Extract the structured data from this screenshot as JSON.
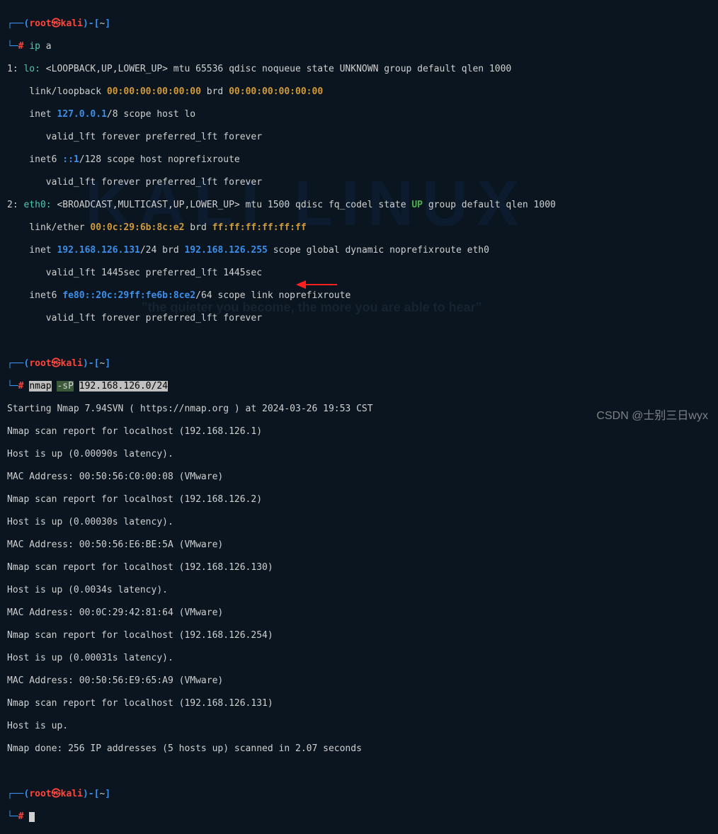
{
  "bg": {
    "logo": "KALI LINUX",
    "tagline": "\"the quieter you become, the more you are able to hear\""
  },
  "prompt": {
    "open": "┌──(",
    "user": "root",
    "at": "㉿",
    "host": "kali",
    "close": ")-[",
    "path": "~",
    "end": "]",
    "line2": "└─",
    "hash": "#"
  },
  "cmd1": {
    "cmd": "ip",
    "arg": "a"
  },
  "ip": {
    "l1_idx": "1: ",
    "l1_ifc": "lo:",
    "l1_rest": " <LOOPBACK,UP,LOWER_UP> mtu 65536 qdisc noqueue state UNKNOWN group default qlen 1000",
    "l2_a": "    link/loopback ",
    "l2_mac1": "00:00:00:00:00:00",
    "l2_b": " brd ",
    "l2_mac2": "00:00:00:00:00:00",
    "l3_a": "    inet ",
    "l3_ip": "127.0.0.1",
    "l3_b": "/8 scope host lo",
    "l4": "       valid_lft forever preferred_lft forever",
    "l5_a": "    inet6 ",
    "l5_ip": "::1",
    "l5_b": "/128 scope host noprefixroute",
    "l6": "       valid_lft forever preferred_lft forever",
    "l7_idx": "2: ",
    "l7_ifc": "eth0:",
    "l7_a": " <BROADCAST,MULTICAST,UP,LOWER_UP> mtu 1500 qdisc fq_codel state ",
    "l7_up": "UP",
    "l7_b": " group default qlen 1000",
    "l8_a": "    link/ether ",
    "l8_mac1": "00:0c:29:6b:8c:e2",
    "l8_b": " brd ",
    "l8_mac2": "ff:ff:ff:ff:ff:ff",
    "l9_a": "    inet ",
    "l9_ip": "192.168.126.131",
    "l9_b": "/24 brd ",
    "l9_brd": "192.168.126.255",
    "l9_c": " scope global dynamic noprefixroute eth0",
    "l10": "       valid_lft 1445sec preferred_lft 1445sec",
    "l11_a": "    inet6 ",
    "l11_ip": "fe80::20c:29ff:fe6b:8ce2",
    "l11_b": "/64 scope link noprefixroute",
    "l12": "       valid_lft forever preferred_lft forever"
  },
  "cmd2": {
    "cmd": "nmap",
    "opt": "-sP",
    "tgt": "192.168.126.0/24"
  },
  "nmap": {
    "l1": "Starting Nmap 7.94SVN ( https://nmap.org ) at 2024-03-26 19:53 CST",
    "l2": "Nmap scan report for localhost (192.168.126.1)",
    "l3": "Host is up (0.00090s latency).",
    "l4": "MAC Address: 00:50:56:C0:00:08 (VMware)",
    "l5": "Nmap scan report for localhost (192.168.126.2)",
    "l6": "Host is up (0.00030s latency).",
    "l7": "MAC Address: 00:50:56:E6:BE:5A (VMware)",
    "l8": "Nmap scan report for localhost (192.168.126.130)",
    "l9": "Host is up (0.0034s latency).",
    "l10": "MAC Address: 00:0C:29:42:81:64 (VMware)",
    "l11": "Nmap scan report for localhost (192.168.126.254)",
    "l12": "Host is up (0.00031s latency).",
    "l13": "MAC Address: 00:50:56:E9:65:A9 (VMware)",
    "l14": "Nmap scan report for localhost (192.168.126.131)",
    "l15": "Host is up.",
    "l16": "Nmap done: 256 IP addresses (5 hosts up) scanned in 2.07 seconds"
  },
  "watermark": "CSDN @士别三日wyx"
}
